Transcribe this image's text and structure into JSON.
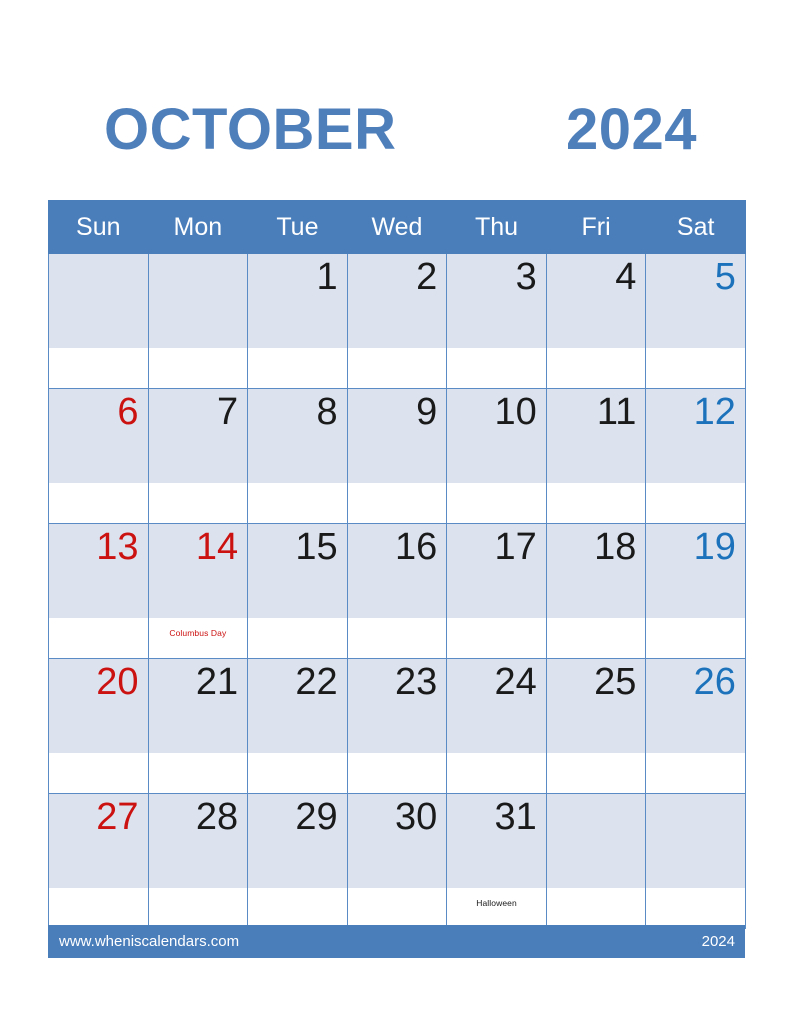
{
  "header": {
    "month": "OCTOBER",
    "year": "2024"
  },
  "theme": {
    "header_blue": "#4a7ebb",
    "title_blue": "#4f7fbb",
    "cell_band": "#dce3ef",
    "grid_line": "#5b8bc4",
    "sunday_red": "#cc1111",
    "saturday_blue": "#1c72bb",
    "weekday_black": "#1a1a1a"
  },
  "weekdays": [
    {
      "label": "Sun"
    },
    {
      "label": "Mon"
    },
    {
      "label": "Tue"
    },
    {
      "label": "Wed"
    },
    {
      "label": "Thu"
    },
    {
      "label": "Fri"
    },
    {
      "label": "Sat"
    }
  ],
  "weeks": [
    [
      {
        "day": "",
        "kind": "blank",
        "event": ""
      },
      {
        "day": "",
        "kind": "blank",
        "event": ""
      },
      {
        "day": "1",
        "kind": "weekday",
        "event": ""
      },
      {
        "day": "2",
        "kind": "weekday",
        "event": ""
      },
      {
        "day": "3",
        "kind": "weekday",
        "event": ""
      },
      {
        "day": "4",
        "kind": "weekday",
        "event": ""
      },
      {
        "day": "5",
        "kind": "sat",
        "event": ""
      }
    ],
    [
      {
        "day": "6",
        "kind": "sun",
        "event": ""
      },
      {
        "day": "7",
        "kind": "weekday",
        "event": ""
      },
      {
        "day": "8",
        "kind": "weekday",
        "event": ""
      },
      {
        "day": "9",
        "kind": "weekday",
        "event": ""
      },
      {
        "day": "10",
        "kind": "weekday",
        "event": ""
      },
      {
        "day": "11",
        "kind": "weekday",
        "event": ""
      },
      {
        "day": "12",
        "kind": "sat",
        "event": ""
      }
    ],
    [
      {
        "day": "13",
        "kind": "sun",
        "event": ""
      },
      {
        "day": "14",
        "kind": "holiday",
        "event": "Columbus Day",
        "event_color": "red"
      },
      {
        "day": "15",
        "kind": "weekday",
        "event": ""
      },
      {
        "day": "16",
        "kind": "weekday",
        "event": ""
      },
      {
        "day": "17",
        "kind": "weekday",
        "event": ""
      },
      {
        "day": "18",
        "kind": "weekday",
        "event": ""
      },
      {
        "day": "19",
        "kind": "sat",
        "event": ""
      }
    ],
    [
      {
        "day": "20",
        "kind": "sun",
        "event": ""
      },
      {
        "day": "21",
        "kind": "weekday",
        "event": ""
      },
      {
        "day": "22",
        "kind": "weekday",
        "event": ""
      },
      {
        "day": "23",
        "kind": "weekday",
        "event": ""
      },
      {
        "day": "24",
        "kind": "weekday",
        "event": ""
      },
      {
        "day": "25",
        "kind": "weekday",
        "event": ""
      },
      {
        "day": "26",
        "kind": "sat",
        "event": ""
      }
    ],
    [
      {
        "day": "27",
        "kind": "sun",
        "event": ""
      },
      {
        "day": "28",
        "kind": "weekday",
        "event": ""
      },
      {
        "day": "29",
        "kind": "weekday",
        "event": ""
      },
      {
        "day": "30",
        "kind": "weekday",
        "event": ""
      },
      {
        "day": "31",
        "kind": "weekday",
        "event": "Halloween",
        "event_color": "black"
      },
      {
        "day": "",
        "kind": "blank",
        "event": ""
      },
      {
        "day": "",
        "kind": "blank",
        "event": ""
      }
    ]
  ],
  "footer": {
    "site": "www.wheniscalendars.com",
    "year": "2024"
  }
}
